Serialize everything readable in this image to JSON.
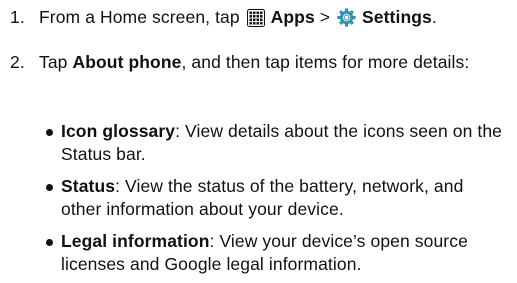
{
  "steps": [
    {
      "number": "1.",
      "before": "From a Home screen, tap ",
      "apps_icon": "apps-grid-icon",
      "apps_label": "Apps",
      "separator": " > ",
      "settings_icon": "settings-gear-icon",
      "settings_label": "Settings",
      "after": "."
    },
    {
      "number": "2.",
      "before": "Tap ",
      "bold": "About phone",
      "after": ", and then tap items for more details:"
    }
  ],
  "items": [
    {
      "title": "Icon glossary",
      "desc": ": View details about the icons seen on the Status bar."
    },
    {
      "title": "Status",
      "desc": ": View the status of the battery, network, and other information about your device."
    },
    {
      "title": "Legal information",
      "desc": ": View your device’s open source licenses and Google legal information."
    }
  ],
  "colors": {
    "text": "#111111",
    "settings_icon": "#3aa7c9"
  }
}
